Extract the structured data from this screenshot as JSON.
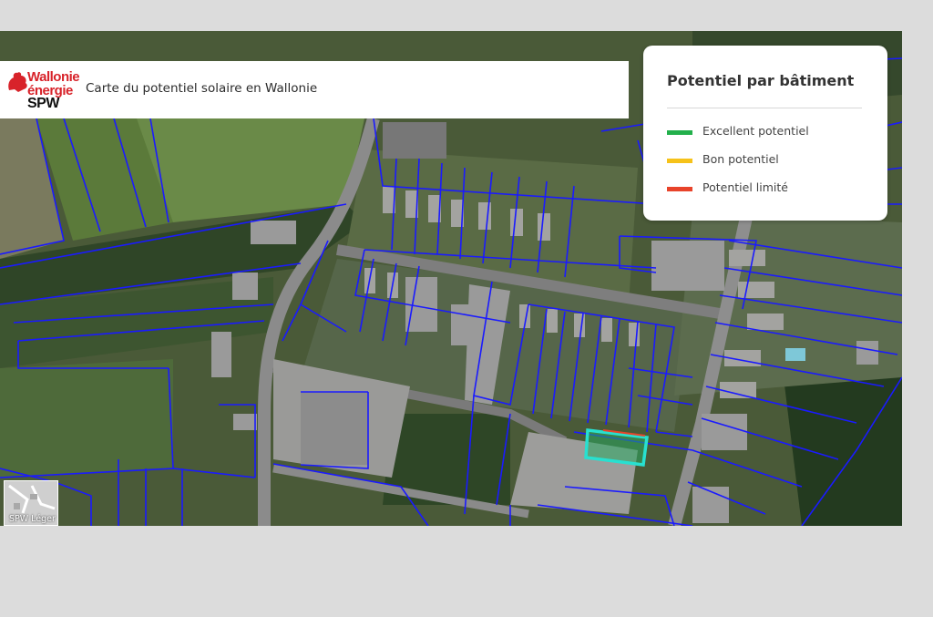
{
  "header": {
    "logo_line1": "Wallonie",
    "logo_line2": "énergie",
    "logo_line3": "SPW",
    "title": "Carte du potentiel solaire en Wallonie"
  },
  "legend": {
    "title": "Potentiel par bâtiment",
    "items": [
      {
        "label": "Excellent potentiel",
        "color": "#22b04b"
      },
      {
        "label": "Bon potentiel",
        "color": "#f6c21a"
      },
      {
        "label": "Potentiel limité",
        "color": "#e8432a"
      }
    ]
  },
  "layer_switcher": {
    "label": "SPW Léger"
  },
  "colors": {
    "parcel_outline": "#1a1aff",
    "selected_building": "#28e0d0",
    "road": "#8b8b8b",
    "brand_red": "#d8232a"
  }
}
